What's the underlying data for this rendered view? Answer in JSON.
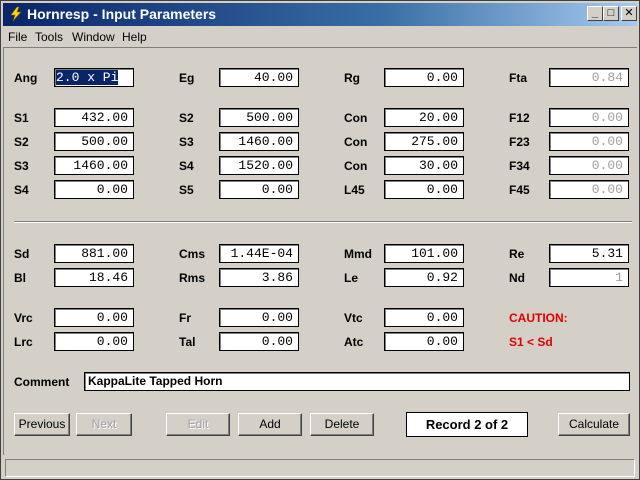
{
  "window": {
    "title": "Hornresp - Input Parameters",
    "controls": {
      "minimize": "_",
      "maximize": "□",
      "close": "✕"
    }
  },
  "menu": [
    "File",
    "Tools",
    "Window",
    "Help"
  ],
  "fields": {
    "ang": {
      "label": "Ang",
      "value": "2.0 x Pi"
    },
    "eg": {
      "label": "Eg",
      "value": "40.00"
    },
    "rg": {
      "label": "Rg",
      "value": "0.00"
    },
    "fta": {
      "label": "Fta",
      "value": "0.84"
    },
    "s1": {
      "label": "S1",
      "value": "432.00"
    },
    "s2a": {
      "label": "S2",
      "value": "500.00"
    },
    "con1": {
      "label": "Con",
      "value": "20.00"
    },
    "f12": {
      "label": "F12",
      "value": "0.00"
    },
    "s2b": {
      "label": "S2",
      "value": "500.00"
    },
    "s3a": {
      "label": "S3",
      "value": "1460.00"
    },
    "con2": {
      "label": "Con",
      "value": "275.00"
    },
    "f23": {
      "label": "F23",
      "value": "0.00"
    },
    "s3b": {
      "label": "S3",
      "value": "1460.00"
    },
    "s4a": {
      "label": "S4",
      "value": "1520.00"
    },
    "con3": {
      "label": "Con",
      "value": "30.00"
    },
    "f34": {
      "label": "F34",
      "value": "0.00"
    },
    "s4b": {
      "label": "S4",
      "value": "0.00"
    },
    "s5": {
      "label": "S5",
      "value": "0.00"
    },
    "l45": {
      "label": "L45",
      "value": "0.00"
    },
    "f45": {
      "label": "F45",
      "value": "0.00"
    },
    "sd": {
      "label": "Sd",
      "value": "881.00"
    },
    "cms": {
      "label": "Cms",
      "value": "1.44E-04"
    },
    "mmd": {
      "label": "Mmd",
      "value": "101.00"
    },
    "re": {
      "label": "Re",
      "value": "5.31"
    },
    "bl": {
      "label": "Bl",
      "value": "18.46"
    },
    "rms": {
      "label": "Rms",
      "value": "3.86"
    },
    "le": {
      "label": "Le",
      "value": "0.92"
    },
    "nd": {
      "label": "Nd",
      "value": "1"
    },
    "vrc": {
      "label": "Vrc",
      "value": "0.00"
    },
    "fr": {
      "label": "Fr",
      "value": "0.00"
    },
    "vtc": {
      "label": "Vtc",
      "value": "0.00"
    },
    "lrc": {
      "label": "Lrc",
      "value": "0.00"
    },
    "tal": {
      "label": "Tal",
      "value": "0.00"
    },
    "atc": {
      "label": "Atc",
      "value": "0.00"
    }
  },
  "caution": {
    "title": "CAUTION:",
    "message": "S1 < Sd"
  },
  "comment": {
    "label": "Comment",
    "value": "KappaLite Tapped Horn"
  },
  "buttons": {
    "previous": "Previous",
    "next": "Next",
    "edit": "Edit",
    "add": "Add",
    "delete": "Delete",
    "calculate": "Calculate"
  },
  "record": "Record 2 of 2",
  "status": "",
  "colors": {
    "caution": "#e00000",
    "titlebar_start": "#0a246a",
    "titlebar_end": "#a6caf0"
  }
}
